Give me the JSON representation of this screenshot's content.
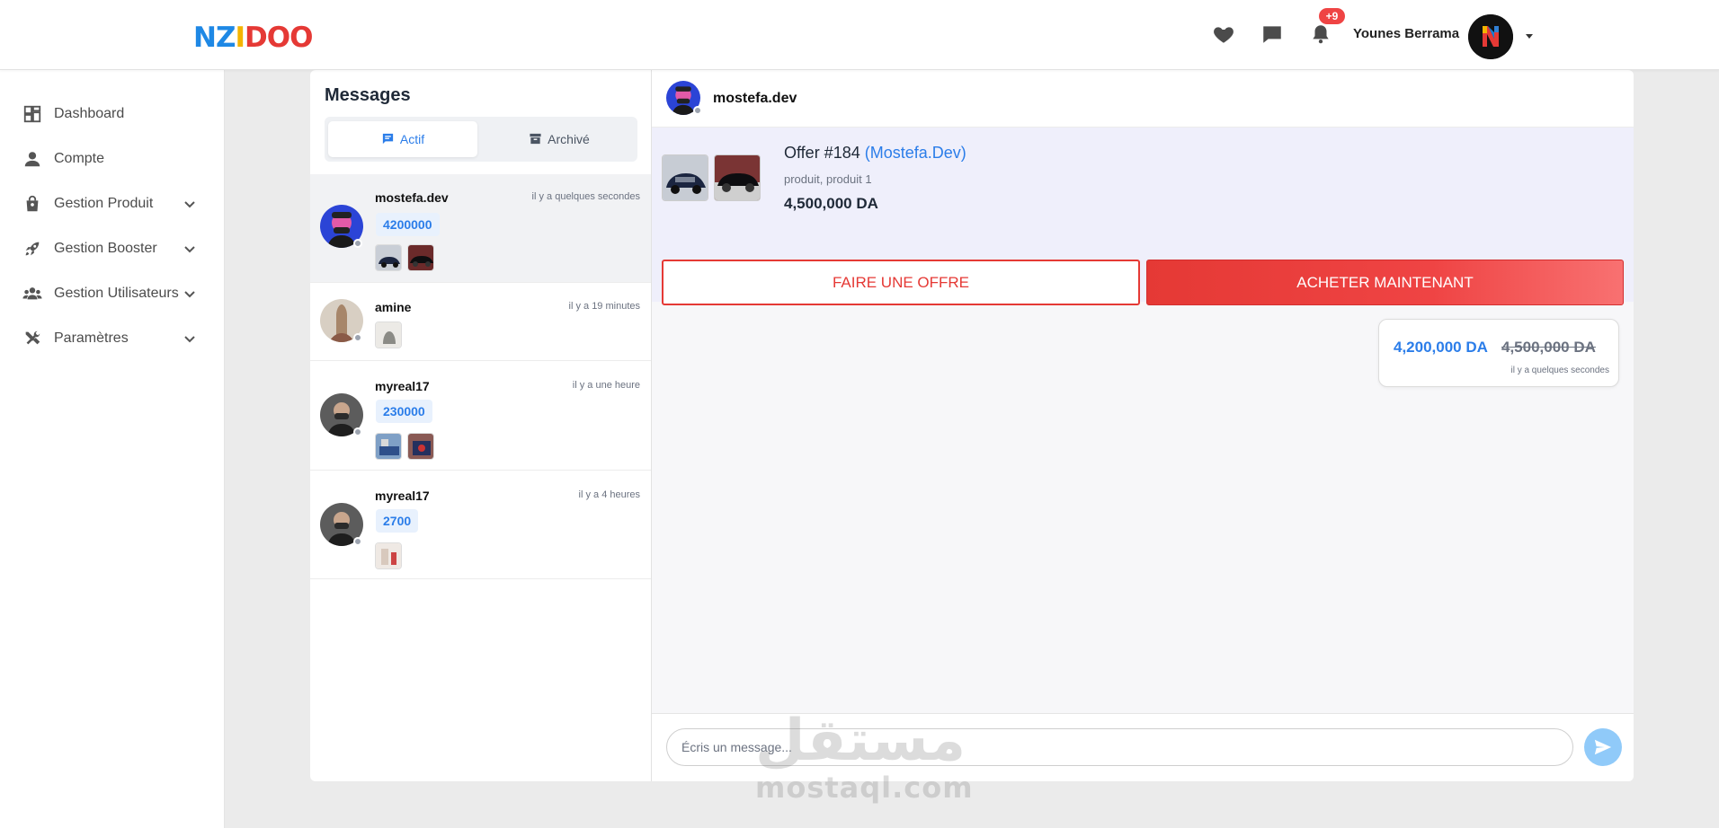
{
  "header": {
    "logo_letters": [
      "N",
      "Z",
      "I",
      "D",
      "O",
      "O"
    ],
    "notification_badge": "+9",
    "user_name": "Younes Berrama",
    "icons": [
      "heart-icon",
      "chat-icon",
      "bell-icon",
      "caret-down-icon"
    ]
  },
  "sidebar": {
    "items": [
      {
        "label": "Dashboard",
        "icon": "dashboard-icon",
        "has_submenu": false
      },
      {
        "label": "Compte",
        "icon": "user-icon",
        "has_submenu": false
      },
      {
        "label": "Gestion Produit",
        "icon": "shopping-bag-icon",
        "has_submenu": true
      },
      {
        "label": "Gestion Booster",
        "icon": "rocket-icon",
        "has_submenu": true
      },
      {
        "label": "Gestion Utilisateurs",
        "icon": "users-icon",
        "has_submenu": true
      },
      {
        "label": "Paramètres",
        "icon": "tools-icon",
        "has_submenu": true
      }
    ]
  },
  "messages": {
    "title": "Messages",
    "tabs": [
      {
        "label": "Actif",
        "active": true
      },
      {
        "label": "Archivé",
        "active": false
      }
    ],
    "conversations": [
      {
        "name": "mostefa.dev",
        "time": "il y a quelques secondes",
        "price": "4200000",
        "selected": true
      },
      {
        "name": "amine",
        "time": "il y a 19 minutes",
        "price": "",
        "selected": false
      },
      {
        "name": "myreal17",
        "time": "il y a une heure",
        "price": "230000",
        "selected": false
      },
      {
        "name": "myreal17",
        "time": "il y a 4 heures",
        "price": "2700",
        "selected": false
      }
    ]
  },
  "chat": {
    "contact_name": "mostefa.dev",
    "offer": {
      "title": "Offer #184",
      "seller": "(Mostefa.Dev)",
      "subtitle": "produit, produit 1",
      "price": "4,500,000 DA"
    },
    "make_offer_label": "FAIRE UNE OFFRE",
    "buy_now_label": "ACHETER MAINTENANT",
    "message": {
      "new_price": "4,200,000 DA",
      "old_price": "4,500,000 DA",
      "time": "il y a quelques secondes"
    },
    "input_placeholder": "Écris un message..."
  },
  "watermark": {
    "arabic": "مستقل",
    "latin": "mostaql.com"
  },
  "colors": {
    "accent_blue": "#2b7de9",
    "danger_red": "#e53935",
    "badge_red": "#ef4444",
    "send_button": "#90caf9"
  }
}
